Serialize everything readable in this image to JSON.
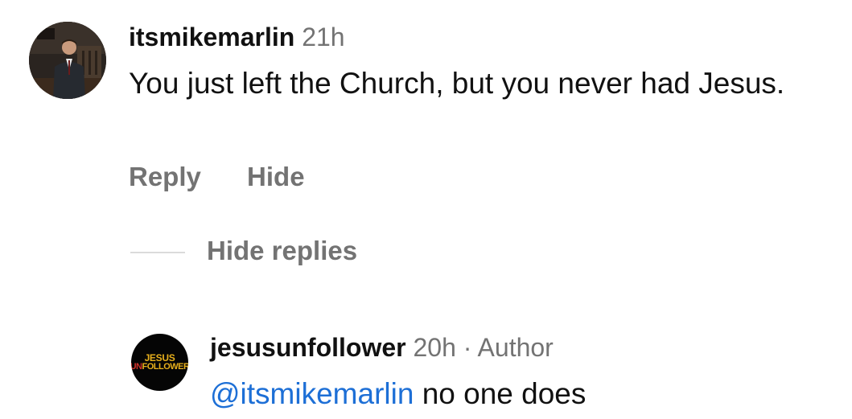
{
  "comment": {
    "username": "itsmikemarlin",
    "time": "21h",
    "text": "You just left the Church, but you never had Jesus.",
    "avatar": "profile-photo-man-in-suit"
  },
  "actions": {
    "reply_label": "Reply",
    "hide_label": "Hide"
  },
  "thread": {
    "hide_replies_label": "Hide replies"
  },
  "reply": {
    "username": "jesusunfollower",
    "time": "20h",
    "separator": "·",
    "role": "Author",
    "mention": "@itsmikemarlin",
    "text": "no one does",
    "avatar": {
      "line1": "JESUS",
      "line2_red": "UN",
      "line2_rest": "FOLLOWER",
      "bg_color": "#050505",
      "text_color": "#e8b01c",
      "accent_color": "#d1312a"
    }
  },
  "colors": {
    "secondary_text": "#737373",
    "mention_blue": "#1d6fd6",
    "divider": "#dbdbdb"
  }
}
